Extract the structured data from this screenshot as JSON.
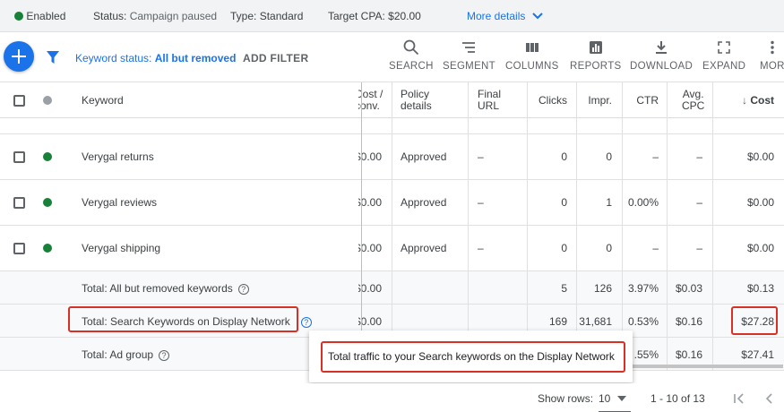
{
  "status_bar": {
    "enabled_label": "Enabled",
    "status_label": "Status:",
    "status_value": "Campaign paused",
    "type_label": "Type:",
    "type_value": "Standard",
    "cpa_label": "Target CPA:",
    "cpa_value": "$20.00",
    "more_details": "More details"
  },
  "toolbar": {
    "keyword_status_prefix": "Keyword status:",
    "keyword_status_value": "All but removed",
    "add_filter": "ADD FILTER",
    "tools": [
      {
        "label": "SEARCH",
        "icon": "search-icon"
      },
      {
        "label": "SEGMENT",
        "icon": "segment-icon"
      },
      {
        "label": "COLUMNS",
        "icon": "columns-icon"
      },
      {
        "label": "REPORTS",
        "icon": "reports-icon"
      },
      {
        "label": "DOWNLOAD",
        "icon": "download-icon"
      },
      {
        "label": "EXPAND",
        "icon": "expand-icon"
      },
      {
        "label": "MOR",
        "icon": "more-vert-icon"
      }
    ]
  },
  "table": {
    "headers": {
      "keyword": "Keyword",
      "cost_conv": [
        "Cost /",
        "conv."
      ],
      "policy": [
        "Policy",
        "details"
      ],
      "final_url": [
        "Final",
        "URL"
      ],
      "clicks": "Clicks",
      "impr": "Impr.",
      "ctr": "CTR",
      "avg_cpc": [
        "Avg.",
        "CPC"
      ],
      "cost": "Cost",
      "sort_arrow": "↓"
    },
    "rows": [
      {
        "keyword": "Verygal returns",
        "cost_conv": "$0.00",
        "policy": "Approved",
        "final_url": "–",
        "clicks": "0",
        "impr": "0",
        "ctr": "–",
        "avg_cpc": "–",
        "cost": "$0.00"
      },
      {
        "keyword": "Verygal reviews",
        "cost_conv": "$0.00",
        "policy": "Approved",
        "final_url": "–",
        "clicks": "0",
        "impr": "1",
        "ctr": "0.00%",
        "avg_cpc": "–",
        "cost": "$0.00"
      },
      {
        "keyword": "Verygal shipping",
        "cost_conv": "$0.00",
        "policy": "Approved",
        "final_url": "–",
        "clicks": "0",
        "impr": "0",
        "ctr": "–",
        "avg_cpc": "–",
        "cost": "$0.00"
      }
    ],
    "totals": [
      {
        "label": "Total: All but removed keywords",
        "cost_conv": "$0.00",
        "clicks": "5",
        "impr": "126",
        "ctr": "3.97%",
        "avg_cpc": "$0.03",
        "cost": "$0.13"
      },
      {
        "label": "Total: Search Keywords on Display Network",
        "cost_conv": "$0.00",
        "clicks": "169",
        "impr": "31,681",
        "ctr": "0.53%",
        "avg_cpc": "$0.16",
        "cost": "$27.28"
      },
      {
        "label": "Total: Ad group",
        "cost_conv": "",
        "clicks": "",
        "impr": "",
        "ctr": ".55%",
        "avg_cpc": "$0.16",
        "cost": "$27.41"
      }
    ]
  },
  "tooltip": {
    "text": "Total traffic to your Search keywords on the Display Network"
  },
  "footer": {
    "show_rows_label": "Show rows:",
    "show_rows_value": "10",
    "range": "1 - 10 of 13"
  },
  "colors": {
    "accent": "#1a73e8",
    "enabled": "#188038",
    "highlight": "#d93025"
  }
}
